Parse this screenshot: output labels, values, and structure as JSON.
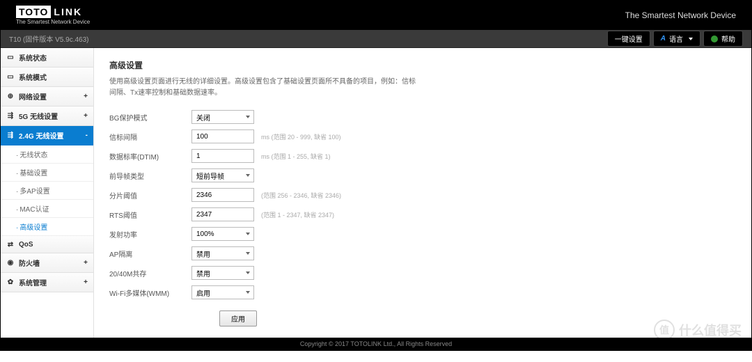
{
  "brand": {
    "part1": "TOTO",
    "part2": "LINK",
    "tagline": "The Smartest Network Device"
  },
  "header_slogan": "The Smartest Network Device",
  "firmware": "T10 (固件版本 V5.9c.463)",
  "toolbar": {
    "quick": "一键设置",
    "lang": "语言",
    "help": "帮助"
  },
  "nav": {
    "status": "系统状态",
    "mode": "系统模式",
    "network": "网络设置",
    "wifi5g": "5G 无线设置",
    "wifi24g": "2.4G 无线设置",
    "qos": "QoS",
    "firewall": "防火墙",
    "sysmgmt": "系统管理",
    "sub": {
      "wstatus": "无线状态",
      "basic": "基础设置",
      "multiap": "多AP设置",
      "mac": "MAC认证",
      "adv": "高级设置"
    }
  },
  "page": {
    "title": "高级设置",
    "desc": "使用高级设置页面进行无线的详细设置。高级设置包含了基础设置页面所不具备的项目，例如：信标间隔、Tx速率控制和基础数据速率。"
  },
  "form": {
    "bg_protect": {
      "label": "BG保护模式",
      "value": "关闭"
    },
    "beacon": {
      "label": "信标间隔",
      "value": "100",
      "hint": "ms (范围 20 - 999, 缺省 100)"
    },
    "dtim": {
      "label": "数据标率(DTIM)",
      "value": "1",
      "hint": "ms (范围 1 - 255, 缺省 1)"
    },
    "preamble": {
      "label": "前导帧类型",
      "value": "短前导帧"
    },
    "frag": {
      "label": "分片阈值",
      "value": "2346",
      "hint": "(范围 256 - 2346, 缺省 2346)"
    },
    "rts": {
      "label": "RTS阈值",
      "value": "2347",
      "hint": "(范围 1 - 2347, 缺省 2347)"
    },
    "txpower": {
      "label": "发射功率",
      "value": "100%"
    },
    "apisolate": {
      "label": "AP隔离",
      "value": "禁用"
    },
    "coexist": {
      "label": "20/40M共存",
      "value": "禁用"
    },
    "wmm": {
      "label": "Wi-Fi多媒体(WMM)",
      "value": "启用"
    }
  },
  "apply": "应用",
  "footer": "Copyright © 2017 TOTOLINK Ltd., All Rights Reserved",
  "watermark": {
    "icon": "值",
    "text": "什么值得买"
  }
}
